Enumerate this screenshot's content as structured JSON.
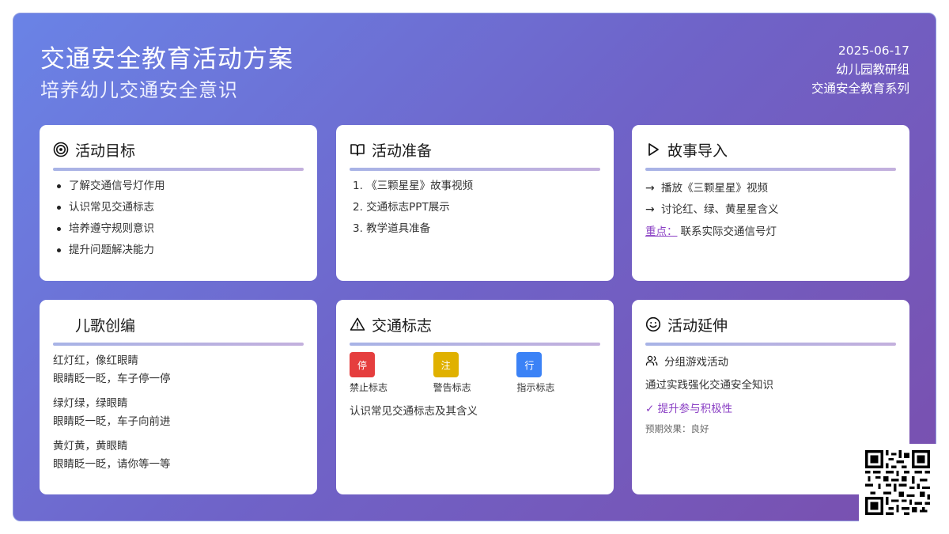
{
  "header": {
    "title": "交通安全教育活动方案",
    "subtitle": "培养幼儿交通安全意识",
    "date": "2025-06-17",
    "group": "幼儿园教研组",
    "series": "交通安全教育系列"
  },
  "cards": {
    "goals": {
      "title": "活动目标",
      "icon": "target-icon",
      "items": [
        "了解交通信号灯作用",
        "认识常见交通标志",
        "培养遵守规则意识",
        "提升问题解决能力"
      ]
    },
    "prep": {
      "title": "活动准备",
      "icon": "book-icon",
      "items": [
        "1. 《三颗星星》故事视频",
        "2. 交通标志PPT展示",
        "3. 教学道具准备"
      ]
    },
    "story": {
      "title": "故事导入",
      "icon": "play-icon",
      "items": [
        "播放《三颗星星》视频",
        "讨论红、绿、黄星星含义"
      ],
      "focus_label": "重点：",
      "focus_text": "联系实际交通信号灯"
    },
    "song": {
      "title": "儿歌创编",
      "verses": [
        [
          "红灯红，像红眼睛",
          "眼睛眨一眨，车子停一停"
        ],
        [
          "绿灯绿，绿眼睛",
          "眼睛眨一眨，车子向前进"
        ],
        [
          "黄灯黄，黄眼睛",
          "眼睛眨一眨，请你等一等"
        ]
      ]
    },
    "signs": {
      "title": "交通标志",
      "icon": "warning-icon",
      "items": [
        {
          "glyph": "停",
          "label": "禁止标志",
          "color": "#e53e3e"
        },
        {
          "glyph": "注",
          "label": "警告标志",
          "color": "#e0b100"
        },
        {
          "glyph": "行",
          "label": "指示标志",
          "color": "#3b82f6"
        }
      ],
      "note": "认识常见交通标志及其含义"
    },
    "extension": {
      "title": "活动延伸",
      "icon": "smile-icon",
      "group_label": "分组游戏活动",
      "line": "通过实践强化交通安全知识",
      "check": "✓ 提升参与积极性",
      "effect": "预期效果：良好"
    }
  },
  "colors": {
    "accent_purple": "#8a3fc4",
    "bg_start": "#6a83e6",
    "bg_end": "#7a4fae"
  }
}
